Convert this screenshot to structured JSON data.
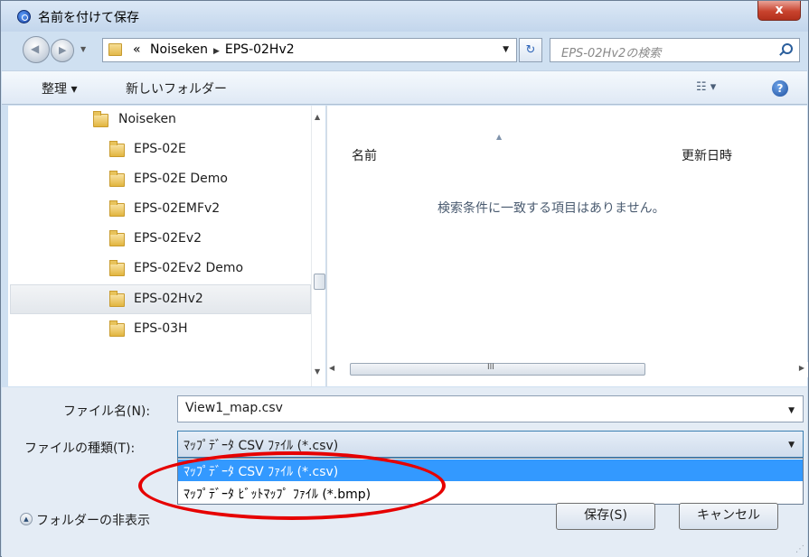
{
  "window": {
    "title": "名前を付けて保存",
    "close_label": "x"
  },
  "address": {
    "overflow": "«",
    "crumbs": [
      "Noiseken",
      "EPS-02Hv2"
    ],
    "search_placeholder": "EPS-02Hv2の検索"
  },
  "toolbar": {
    "organize": "整理 ▾",
    "new_folder": "新しいフォルダー",
    "view": "☷ ▾",
    "help": "?"
  },
  "folders": [
    "Noiseken",
    "EPS-02E",
    "EPS-02E Demo",
    "EPS-02EMFv2",
    "EPS-02Ev2",
    "EPS-02Ev2 Demo",
    "EPS-02Hv2",
    "EPS-03H"
  ],
  "selected_folder": "EPS-02Hv2",
  "file_list": {
    "col_name": "名前",
    "col_date": "更新日時",
    "empty_message": "検索条件に一致する項目はありません。",
    "hscroll_grip": "III"
  },
  "form": {
    "filename_label": "ファイル名(N):",
    "filename_value": "View1_map.csv",
    "filetype_label": "ファイルの種類(T):",
    "filetype_value": "ﾏｯﾌﾟﾃﾞｰﾀ CSV ﾌｧｲﾙ (*.csv)",
    "filetype_options": [
      "ﾏｯﾌﾟﾃﾞｰﾀ CSV ﾌｧｲﾙ (*.csv)",
      "ﾏｯﾌﾟﾃﾞｰﾀ ﾋﾞｯﾄﾏｯﾌﾟ ﾌｧｲﾙ (*.bmp)"
    ],
    "save_label": "保存(S)",
    "cancel_label": "キャンセル",
    "hide_folders_label": "フォルダーの非表示"
  },
  "colors": {
    "highlight": "#3399ff",
    "annotation": "#e60000",
    "close_button": "#c8432e"
  }
}
